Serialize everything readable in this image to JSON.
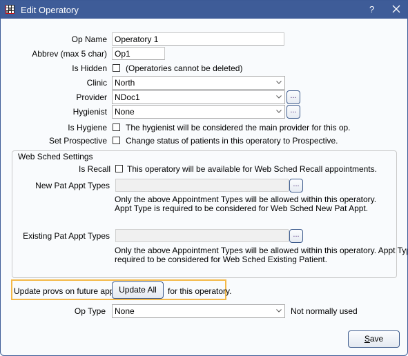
{
  "window": {
    "title": "Edit Operatory",
    "help_label": "?",
    "app_icon": "grid-app-icon",
    "close_icon": "close-icon"
  },
  "form": {
    "op_name": {
      "label": "Op Name",
      "value": "Operatory 1"
    },
    "abbrev": {
      "label": "Abbrev (max 5 char)",
      "value": "Op1"
    },
    "is_hidden": {
      "label": "Is Hidden",
      "checked": false,
      "note": "(Operatories cannot be deleted)"
    },
    "clinic": {
      "label": "Clinic",
      "value": "North"
    },
    "provider": {
      "label": "Provider",
      "value": "NDoc1",
      "button_label": "..."
    },
    "hygienist": {
      "label": "Hygienist",
      "value": "None",
      "button_label": "..."
    },
    "is_hygiene": {
      "label": "Is Hygiene",
      "checked": false,
      "note": "The hygienist will be considered the main provider for this op."
    },
    "set_prospective": {
      "label": "Set Prospective",
      "checked": false,
      "note": "Change status of patients in this operatory to Prospective."
    }
  },
  "web_sched": {
    "title": "Web Sched Settings",
    "is_recall": {
      "label": "Is Recall",
      "checked": false,
      "note": "This operatory will be available for Web Sched Recall appointments."
    },
    "new_pat": {
      "label": "New Pat Appt Types",
      "value": "",
      "button_label": "...",
      "note_line1": "Only the above Appointment Types will be allowed within this operatory.",
      "note_line2": "Appt Type is required to be considered for Web Sched New Pat Appt."
    },
    "existing_pat": {
      "label": "Existing Pat Appt Types",
      "value": "",
      "button_label": "...",
      "note_line1": "Only the above Appointment Types will be allowed within this operatory. Appt Type is",
      "note_line2": "required to be considered for Web Sched Existing Patient."
    }
  },
  "update_provs": {
    "prefix": "Update provs on future appts",
    "button_label": "Update All",
    "suffix": "for this operatory.",
    "highlight_color": "#f4b847"
  },
  "op_type": {
    "label": "Op Type",
    "value": "None",
    "note": "Not normally used"
  },
  "footer": {
    "save_label": "Save",
    "save_mnemonic": "S",
    "save_rest": "ave"
  },
  "colors": {
    "titlebar": "#3e5c98",
    "button_border": "#3c5a8c"
  }
}
